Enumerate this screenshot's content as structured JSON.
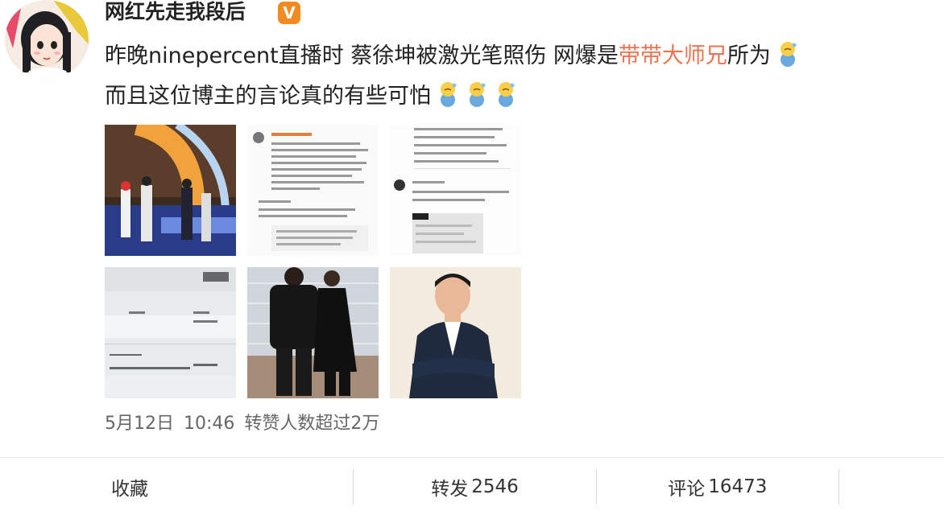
{
  "post": {
    "username": "网红先走我段后",
    "verified_badge": "V",
    "text_line1_a": "昨晚ninepercent直播时 蔡徐坤被激光笔照伤 网爆是",
    "mention": "带带大师兄",
    "text_line1_b": "所为",
    "text_line2": "而且这位博主的言论真的有些可怕",
    "emoji_name": "sweat-emoji",
    "meta": {
      "date": "5月12日",
      "time": "10:46",
      "repost_note": "转赞人数超过2万"
    }
  },
  "actions": {
    "favorite_label": "收藏",
    "repost_label": "转发",
    "repost_count": "2546",
    "comment_label": "评论",
    "comment_count": "16473"
  },
  "colors": {
    "mention": "#eb7350",
    "badge": "#f28b1f",
    "text": "#222222",
    "meta": "#666666"
  }
}
